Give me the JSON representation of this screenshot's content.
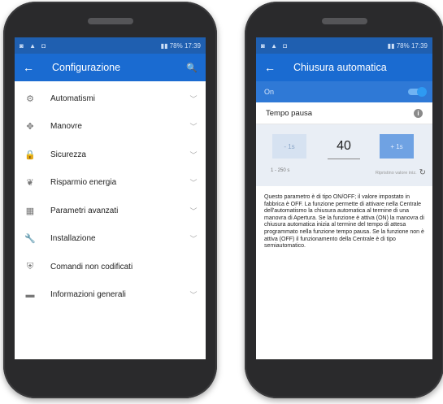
{
  "status_bar": {
    "left_icons": [
      "◙",
      "▲",
      "◘"
    ],
    "right_text": "17:39",
    "battery": "78%"
  },
  "left_screen": {
    "title": "Configurazione",
    "menu_items": [
      {
        "label": "Automatismi",
        "icon": "gear-icon",
        "glyph": "⚙"
      },
      {
        "label": "Manovre",
        "icon": "move-icon",
        "glyph": "✥"
      },
      {
        "label": "Sicurezza",
        "icon": "lock-icon",
        "glyph": "🔒"
      },
      {
        "label": "Risparmio energia",
        "icon": "leaf-icon",
        "glyph": "❦"
      },
      {
        "label": "Parametri avanzati",
        "icon": "grid-icon",
        "glyph": "▦"
      },
      {
        "label": "Installazione",
        "icon": "wrench-icon",
        "glyph": "🔧"
      },
      {
        "label": "Comandi non codificati",
        "icon": "shield-icon",
        "glyph": "⛨"
      },
      {
        "label": "Informazioni generali",
        "icon": "folder-icon",
        "glyph": "▬"
      }
    ]
  },
  "right_screen": {
    "title": "Chiusura automatica",
    "toggle_label": "On",
    "toggle_on": true,
    "section_title": "Tempo pausa",
    "minus_label": "- 1s",
    "value": "40",
    "plus_label": "+ 1s",
    "range": "1 - 250 s",
    "reset_label": "Ripristino valore iniz.",
    "description": "Questo parametro è di tipo ON/OFF; il valore impostato in fabbrica è OFF. La funzione permette di attivare nella Centrale dell'automatismo la chiusura automatica al termine di una manovra di Apertura. Se la funzione è attiva (ON) la manovra di chiusura automatica inizia al termine del tempo di attesa programmato nella funzione tempo pausa. Se la funzione non è attiva (OFF) il funzionamento della Centrale è di tipo semiautomatico."
  },
  "colors": {
    "appbar": "#1a6bd1",
    "statusbar": "#1f5fb0",
    "toggle_bar": "#2f79d6",
    "phone_body": "#2a2a2c"
  }
}
